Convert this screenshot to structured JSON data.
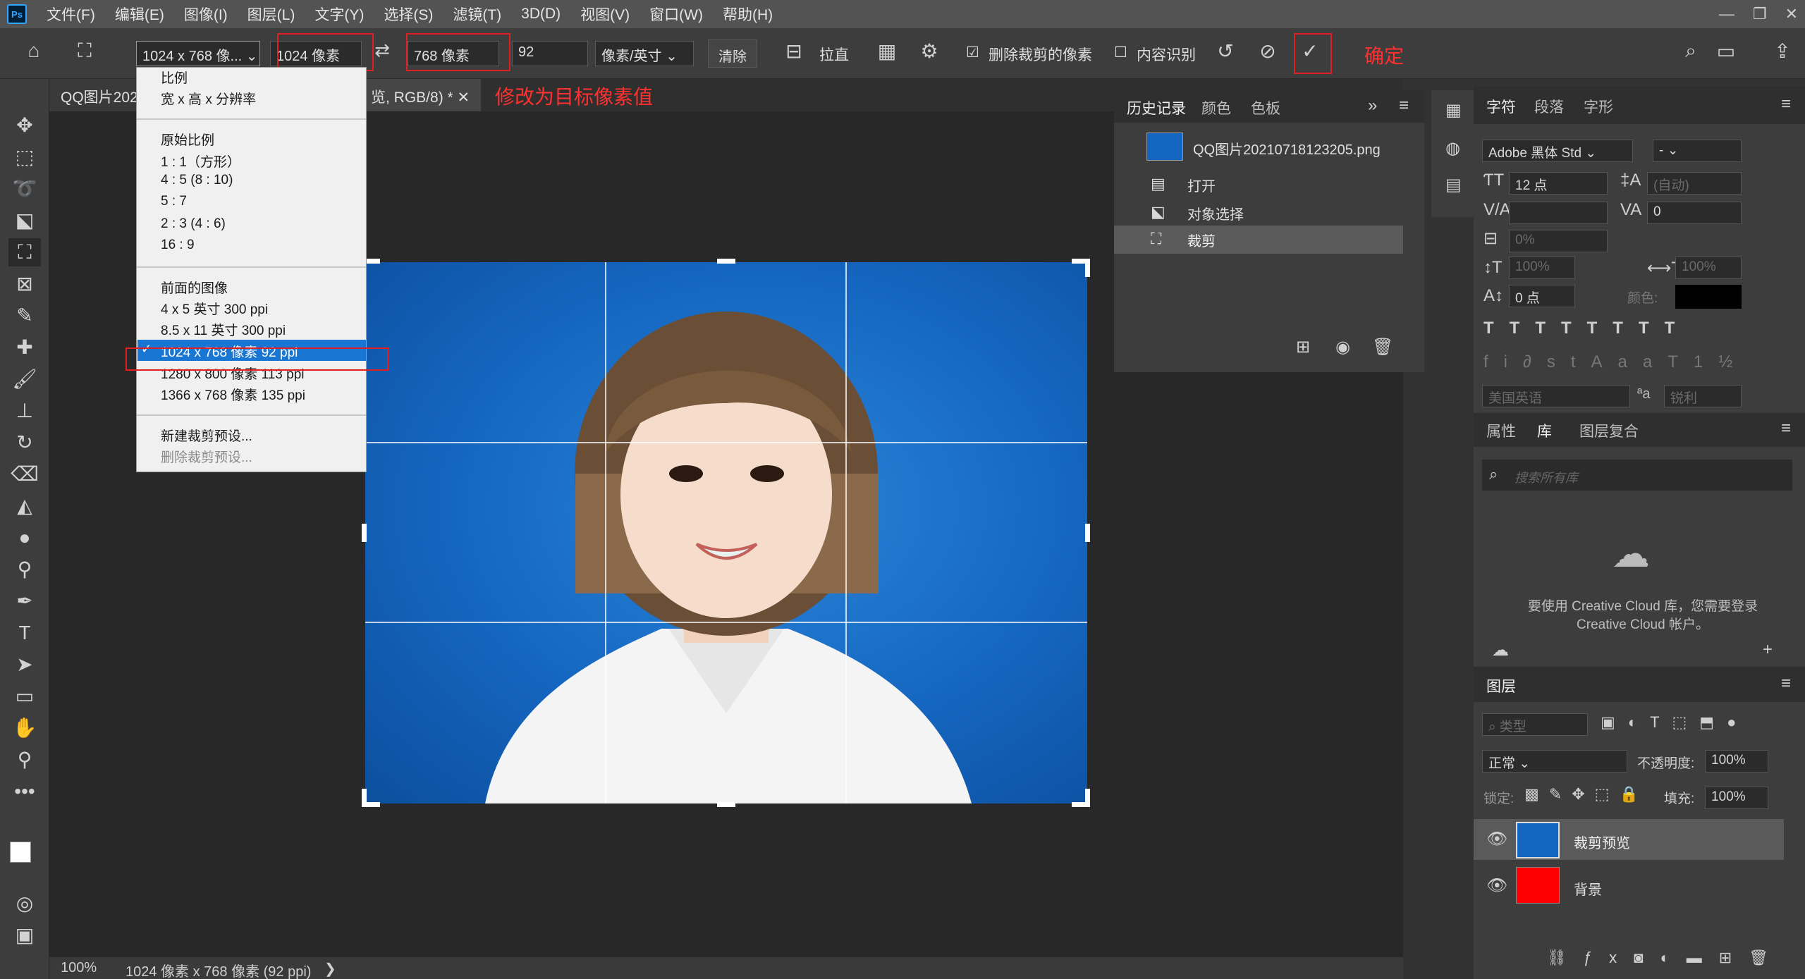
{
  "app": {
    "logo": "Ps"
  },
  "menu": [
    "文件(F)",
    "编辑(E)",
    "图像(I)",
    "图层(L)",
    "文字(Y)",
    "选择(S)",
    "滤镜(T)",
    "3D(D)",
    "视图(V)",
    "窗口(W)",
    "帮助(H)"
  ],
  "options": {
    "preset": "1024 x 768 像...",
    "width": "1024 像素",
    "height": "768 像素",
    "resolution": "92",
    "unit": "像素/英寸",
    "clear": "清除",
    "straighten": "拉直",
    "delete_cropped": "删除裁剪的像素",
    "content_aware": "内容识别",
    "confirm_annotation": "确定"
  },
  "tabs": {
    "doc1": "QQ图片202",
    "doc2": "览, RGB/8) *",
    "annotation": "修改为目标像素值"
  },
  "dropdown": {
    "items_a": [
      "比例",
      "宽 x 高 x 分辨率"
    ],
    "items_b": [
      "原始比例",
      "1 : 1（方形）",
      "4 : 5 (8 : 10)",
      "5 : 7",
      "2 : 3 (4 : 6)",
      "16 : 9"
    ],
    "items_c": [
      "前面的图像",
      "4 x 5 英寸 300 ppi",
      "8.5 x 11 英寸 300 ppi",
      "1024 x 768 像素 92 ppi",
      "1280 x 800 像素 113 ppi",
      "1366 x 768 像素 135 ppi"
    ],
    "items_d": [
      "新建裁剪预设...",
      "删除裁剪预设..."
    ]
  },
  "history": {
    "tabs": [
      "历史记录",
      "颜色",
      "色板"
    ],
    "snapshot": "QQ图片20210718123205.png",
    "steps": [
      "打开",
      "对象选择",
      "裁剪"
    ]
  },
  "character": {
    "tabs": [
      "字符",
      "段落",
      "字形"
    ],
    "font": "Adobe 黑体 Std",
    "style": "-",
    "size": "12 点",
    "leading": "(自动)",
    "tracking": "0",
    "scale": "0%",
    "vscale": "100%",
    "hscale": "100%",
    "baseline": "0 点",
    "color_label": "颜色:",
    "language": "美国英语",
    "aa_label": "ªa",
    "antialias": "锐利"
  },
  "library": {
    "tabs": [
      "属性",
      "库",
      "图层复合"
    ],
    "search_placeholder": "搜索所有库",
    "message": "要使用 Creative Cloud 库，您需要登录 Creative Cloud 帐户。"
  },
  "layers": {
    "title": "图层",
    "filter": "类型",
    "blend": "正常",
    "opacity_label": "不透明度:",
    "opacity": "100%",
    "lock_label": "锁定:",
    "fill_label": "填充:",
    "fill": "100%",
    "items": [
      "裁剪预览",
      "背景"
    ]
  },
  "status": {
    "zoom": "100%",
    "info": "1024 像素 x 768 像素 (92 ppi)",
    "arrow": "❯"
  },
  "colors": {
    "accent": "#1976d2",
    "annotation_red": "#ff3030",
    "photo_blue": "#1566c0",
    "layer_bg_red": "#ff0000"
  }
}
